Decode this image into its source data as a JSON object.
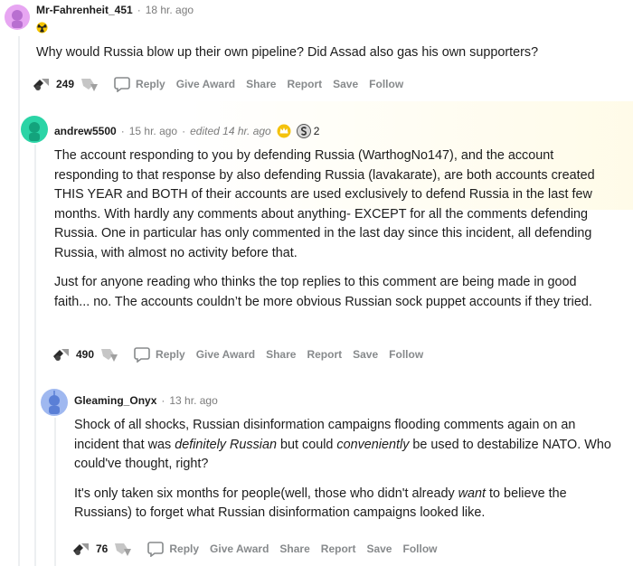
{
  "comments": [
    {
      "author": "Mr-Fahrenheit_451",
      "time": "18 hr. ago",
      "flair_icon": "radiation-icon",
      "paragraphs": [
        "Why would Russia blow up their own pipeline? Did Assad also gas his own supporters?"
      ],
      "score": "249",
      "avatar_color": "#e7a6f2"
    },
    {
      "author": "andrew5500",
      "time": "15 hr. ago",
      "edited": "edited 14 hr. ago",
      "award_count": "2",
      "paragraphs": [
        "The account responding to you by defending Russia (WarthogNo147), and the account responding to that response by also defending Russia (lavakarate), are both accounts created THIS YEAR and BOTH of their accounts are used exclusively to defend Russia in the last few months. With hardly any comments about anything- EXCEPT for all the comments defending Russia. One in particular has only commented in the last day since this incident, all defending Russia, with almost no activity before that.",
        "Just for anyone reading who thinks the top replies to this comment are being made in good faith... no. The accounts couldn’t be more obvious Russian sock puppet accounts if they tried."
      ],
      "score": "490",
      "avatar_color": "#2bd4a6"
    },
    {
      "author": "Gleaming_Onyx",
      "time": "13 hr. ago",
      "paragraphs_rich": [
        [
          "Shock of all shocks, Russian disinformation campaigns flooding comments again on an incident that was ",
          "definitely Russian",
          " but could ",
          "conveniently",
          " be used to destabilize NATO. Who could've thought, right?"
        ],
        [
          "It's only taken six months for people(well, those who didn't already ",
          "want",
          " to believe the Russians) to forget what Russian disinformation campaigns looked like."
        ]
      ],
      "score": "76",
      "avatar_color": "#9fb8f0"
    }
  ],
  "actions": {
    "reply": "Reply",
    "give_award": "Give Award",
    "share": "Share",
    "report": "Report",
    "save": "Save",
    "follow": "Follow"
  }
}
